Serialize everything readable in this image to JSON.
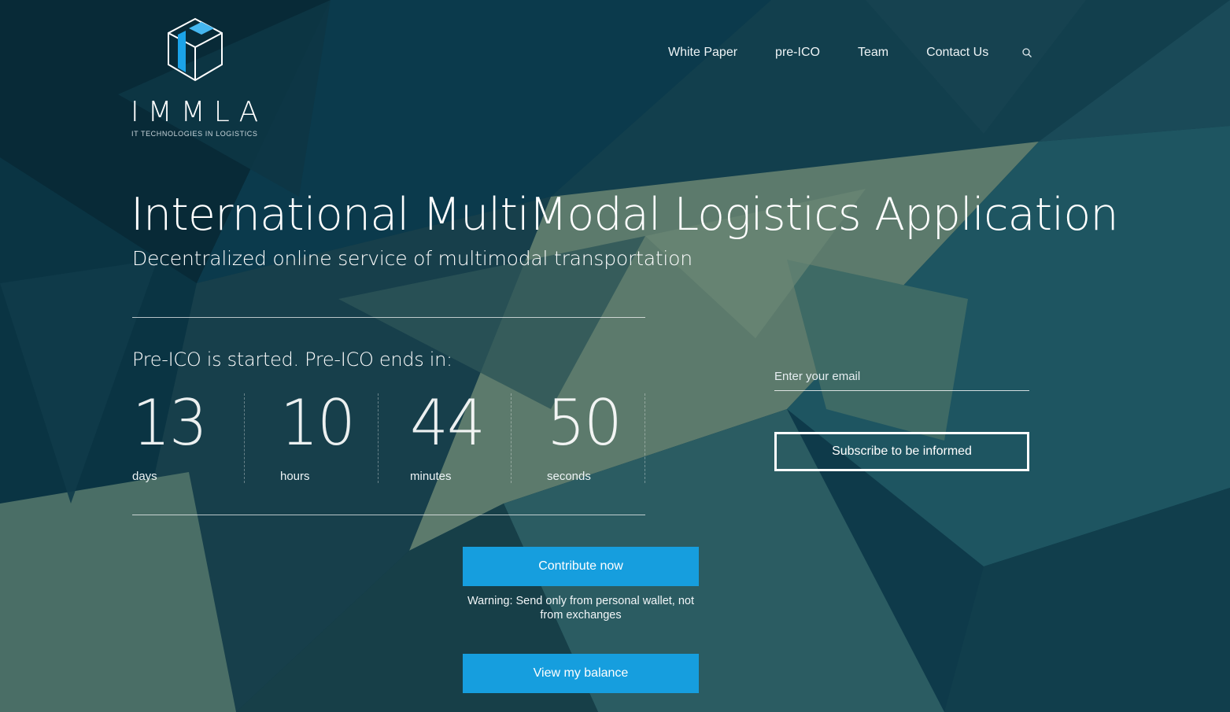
{
  "brand": {
    "name": "IMMLA",
    "tagline": "IT TECHNOLOGIES IN LOGISTICS",
    "accent_color": "#169ede"
  },
  "nav": {
    "items": [
      {
        "label": "White Paper"
      },
      {
        "label": "pre-ICO"
      },
      {
        "label": "Team"
      },
      {
        "label": "Contact Us"
      }
    ],
    "search_icon": "search-icon"
  },
  "hero": {
    "title": "International MultiModal Logistics Application",
    "subtitle": "Decentralized online service of multimodal transportation"
  },
  "countdown": {
    "label": "Pre-ICO is started. Pre-ICO ends in:",
    "days": {
      "value": "13",
      "unit": "days"
    },
    "hours": {
      "value": "10",
      "unit": "hours"
    },
    "minutes": {
      "value": "44",
      "unit": "minutes"
    },
    "seconds": {
      "value": "50",
      "unit": "seconds"
    }
  },
  "subscribe": {
    "email_placeholder": "Enter your email",
    "email_value": "",
    "button_label": "Subscribe to be informed"
  },
  "actions": {
    "contribute_label": "Contribute now",
    "warning": "Warning: Send only from personal wallet, not from exchanges",
    "balance_label": "View my balance"
  }
}
